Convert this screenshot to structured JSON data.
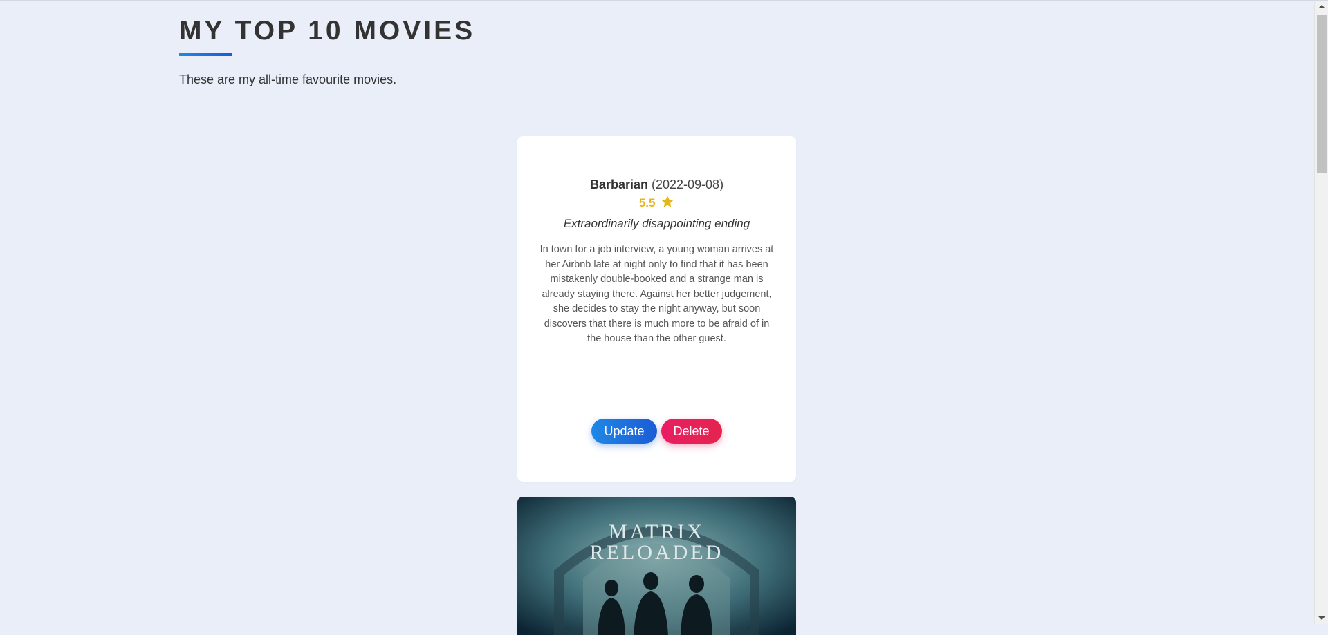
{
  "page": {
    "heading": "MY TOP 10 MOVIES",
    "intro": "These are my all-time favourite movies."
  },
  "movies": [
    {
      "title": "Barbarian",
      "year": "(2022-09-08)",
      "rating": "5.5",
      "review": "Extraordinarily disappointing ending",
      "description": "In town for a job interview, a young woman arrives at her Airbnb late at night only to find that it has been mistakenly double-booked and a strange man is already staying there. Against her better judgement, she decides to stay the night anyway, but soon discovers that there is much more to be afraid of in the house than the other guest.",
      "update_label": "Update",
      "delete_label": "Delete"
    },
    {
      "poster_text_line1": "MATRIX",
      "poster_text_line2": "RELOADED"
    }
  ],
  "colors": {
    "background": "#e9eef8",
    "accent_blue": "#1e88e5",
    "accent_pink": "#e91e63",
    "rating_gold": "#e8b418"
  },
  "icons": {
    "rating": "star-icon"
  }
}
